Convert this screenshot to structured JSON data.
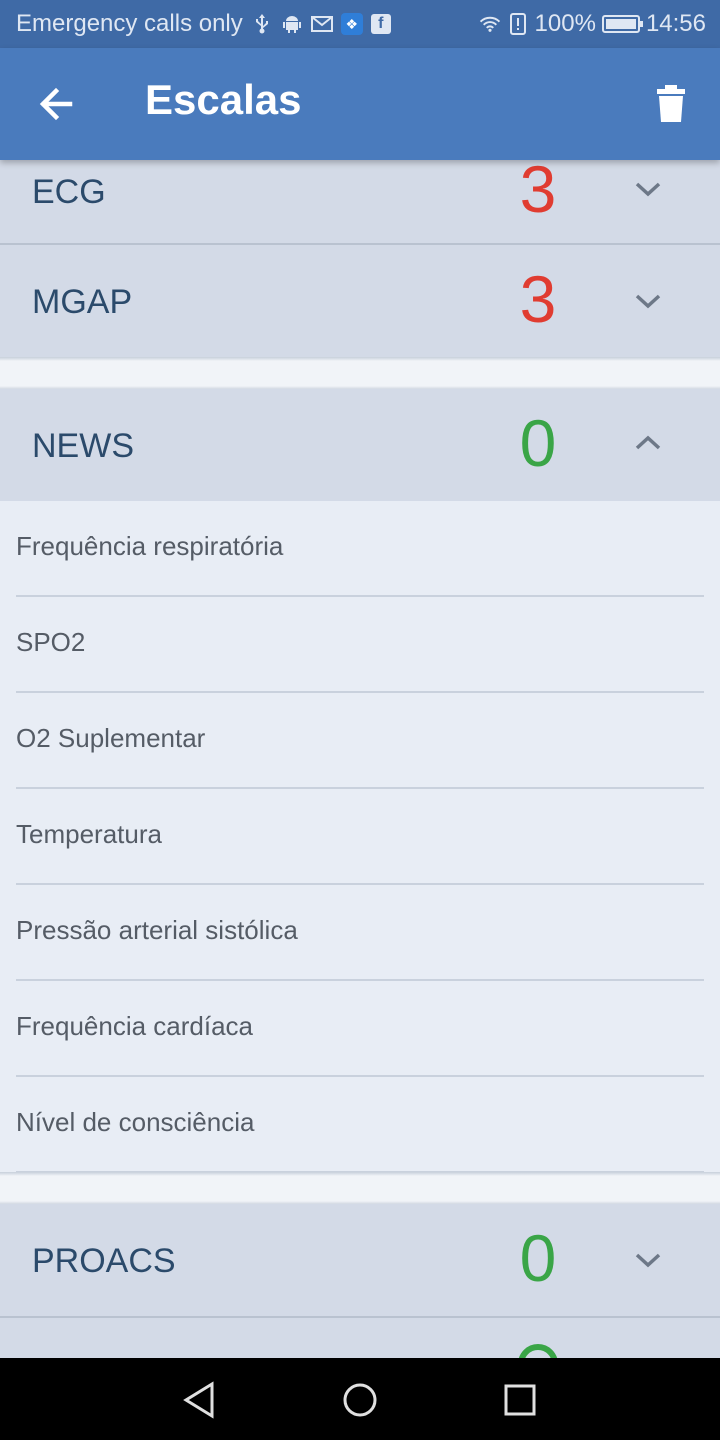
{
  "status_bar": {
    "carrier": "Emergency calls only",
    "battery": "100%",
    "time": "14:56",
    "icons": [
      "usb-icon",
      "android-icon",
      "gmail-icon",
      "app-icon",
      "facebook-icon",
      "wifi-icon",
      "alert-icon",
      "battery-icon"
    ]
  },
  "app_bar": {
    "title": "Escalas",
    "back_icon": "arrow-left-icon",
    "delete_icon": "trash-icon"
  },
  "scales": [
    {
      "name": "ECG",
      "score": "3",
      "score_color": "#e03c31",
      "expanded": false
    },
    {
      "name": "MGAP",
      "score": "3",
      "score_color": "#e03c31",
      "expanded": false
    },
    {
      "name": "NEWS",
      "score": "0",
      "score_color": "#3aa547",
      "expanded": true,
      "items": [
        "Frequência respiratória",
        "SPO2",
        "O2 Suplementar",
        "Temperatura",
        "Pressão arterial sistólica",
        "Frequência cardíaca",
        "Nível de consciência"
      ]
    },
    {
      "name": "PROACS",
      "score": "0",
      "score_color": "#3aa547",
      "expanded": false
    }
  ],
  "colors": {
    "status_bar": "#3f6aa6",
    "app_bar": "#4a7bbd",
    "card_header": "#d3dae7",
    "expanded_panel": "#e8edf5",
    "score_red": "#e03c31",
    "score_green": "#3aa547"
  },
  "nav_bar": {
    "buttons": [
      "back-triangle-icon",
      "home-circle-icon",
      "recents-square-icon"
    ]
  }
}
